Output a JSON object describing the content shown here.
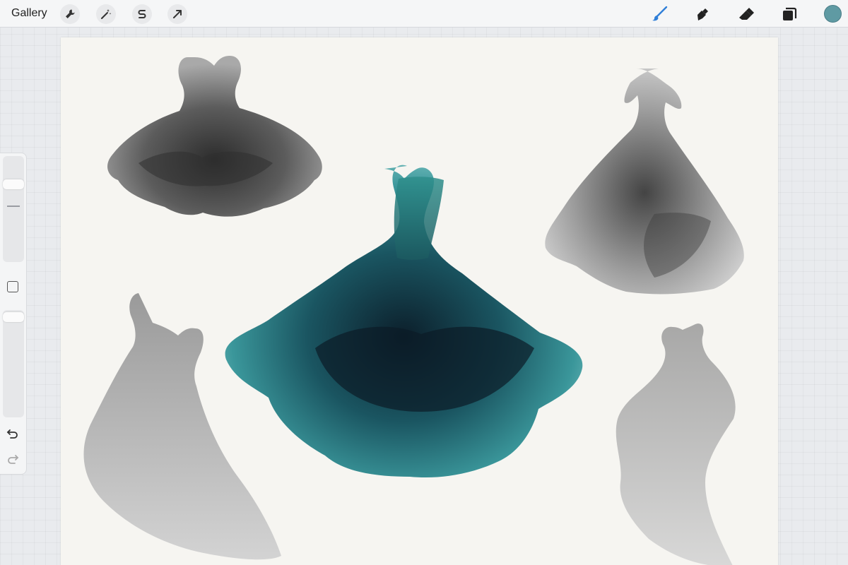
{
  "topbar": {
    "gallery_label": "Gallery",
    "left_tools": [
      {
        "icon": "wrench-icon",
        "name": "actions-button"
      },
      {
        "icon": "magic-wand-icon",
        "name": "adjustments-button"
      },
      {
        "icon": "selection-s-icon",
        "name": "selection-button"
      },
      {
        "icon": "arrow-cursor-icon",
        "name": "transform-button"
      }
    ],
    "right_tools": [
      {
        "icon": "brush-icon",
        "name": "paint-brush-tool",
        "active": true
      },
      {
        "icon": "smudge-icon",
        "name": "smudge-tool"
      },
      {
        "icon": "eraser-icon",
        "name": "eraser-tool"
      },
      {
        "icon": "layers-icon",
        "name": "layers-button"
      }
    ],
    "active_color": "#5f9aa3"
  },
  "sidebar": {
    "brush_size_icon": "size-slider",
    "modify_icon": "square-icon",
    "opacity_icon": "opacity-slider",
    "undo_icon": "undo-icon",
    "redo_icon": "redo-icon"
  },
  "canvas": {
    "artwork": "watercolor-ball-gowns",
    "colors": {
      "paper": "#f6f5f1",
      "teal_dark": "#0f2c37",
      "teal_mid": "#2a7d84",
      "teal_light": "#6fbcbf",
      "gray_dark": "#3b3b3b",
      "gray_mid": "#8a8a8a",
      "gray_light": "#c9c9c9"
    }
  }
}
